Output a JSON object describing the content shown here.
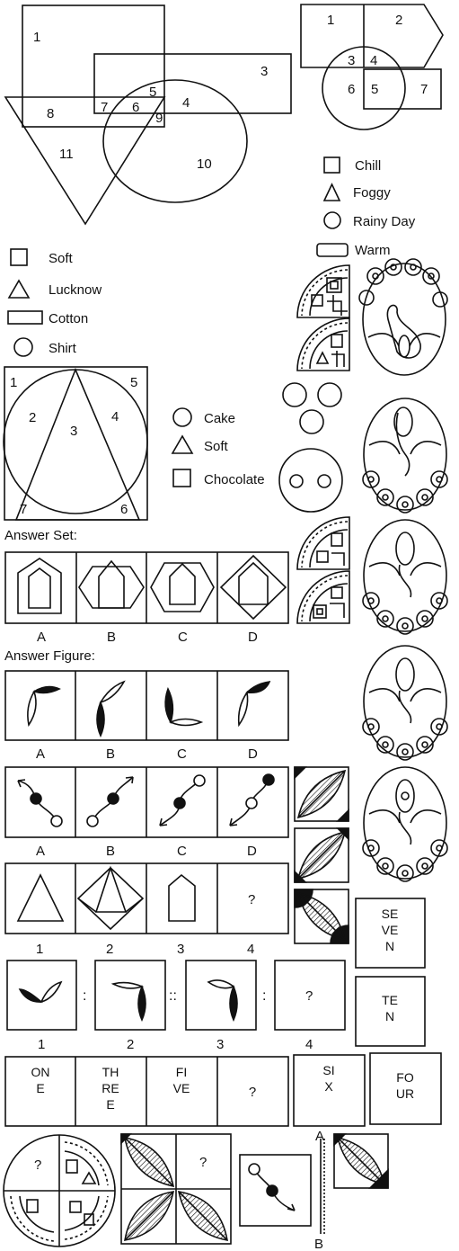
{
  "venn1": {
    "n1": "1",
    "n3": "3",
    "n4": "4",
    "n5": "5",
    "n6": "6",
    "n7": "7",
    "n8": "8",
    "n9": "9",
    "n10": "10",
    "n11": "11"
  },
  "venn2": {
    "n1": "1",
    "n2": "2",
    "n3": "3",
    "n4": "4",
    "n5": "5",
    "n6": "6",
    "n7": "7"
  },
  "legend_weather": {
    "square": "Chill",
    "triangle": "Foggy",
    "circle": "Rainy Day",
    "rect": "Warm"
  },
  "legend_clothes": {
    "square": "Soft",
    "triangle": "Lucknow",
    "rect": "Cotton",
    "circle": "Shirt"
  },
  "venn3": {
    "n1": "1",
    "n2": "2",
    "n3": "3",
    "n4": "4",
    "n5": "5",
    "n6": "6",
    "n7": "7"
  },
  "legend_cake": {
    "circle": "Cake",
    "triangle": "Soft",
    "square": "Chocolate"
  },
  "answer_set_title": "Answer Set:",
  "answer_figure_title": "Answer Figure:",
  "labels_abcd": [
    "A",
    "B",
    "C",
    "D"
  ],
  "labels_1234": [
    "1",
    "2",
    "3",
    "4"
  ],
  "question_mark": "?",
  "colon": ":",
  "double_colon": "::",
  "word_boxes": [
    [
      "ON",
      "E"
    ],
    [
      "TH",
      "RE",
      "E"
    ],
    [
      "FI",
      "VE"
    ]
  ],
  "word_options": {
    "seven": [
      "SE",
      "VE",
      "N"
    ],
    "ten": [
      "TE",
      "N"
    ],
    "six": [
      "SI",
      "X"
    ],
    "four": [
      "FO",
      "UR"
    ]
  },
  "axis": {
    "a": "A",
    "b": "B"
  }
}
